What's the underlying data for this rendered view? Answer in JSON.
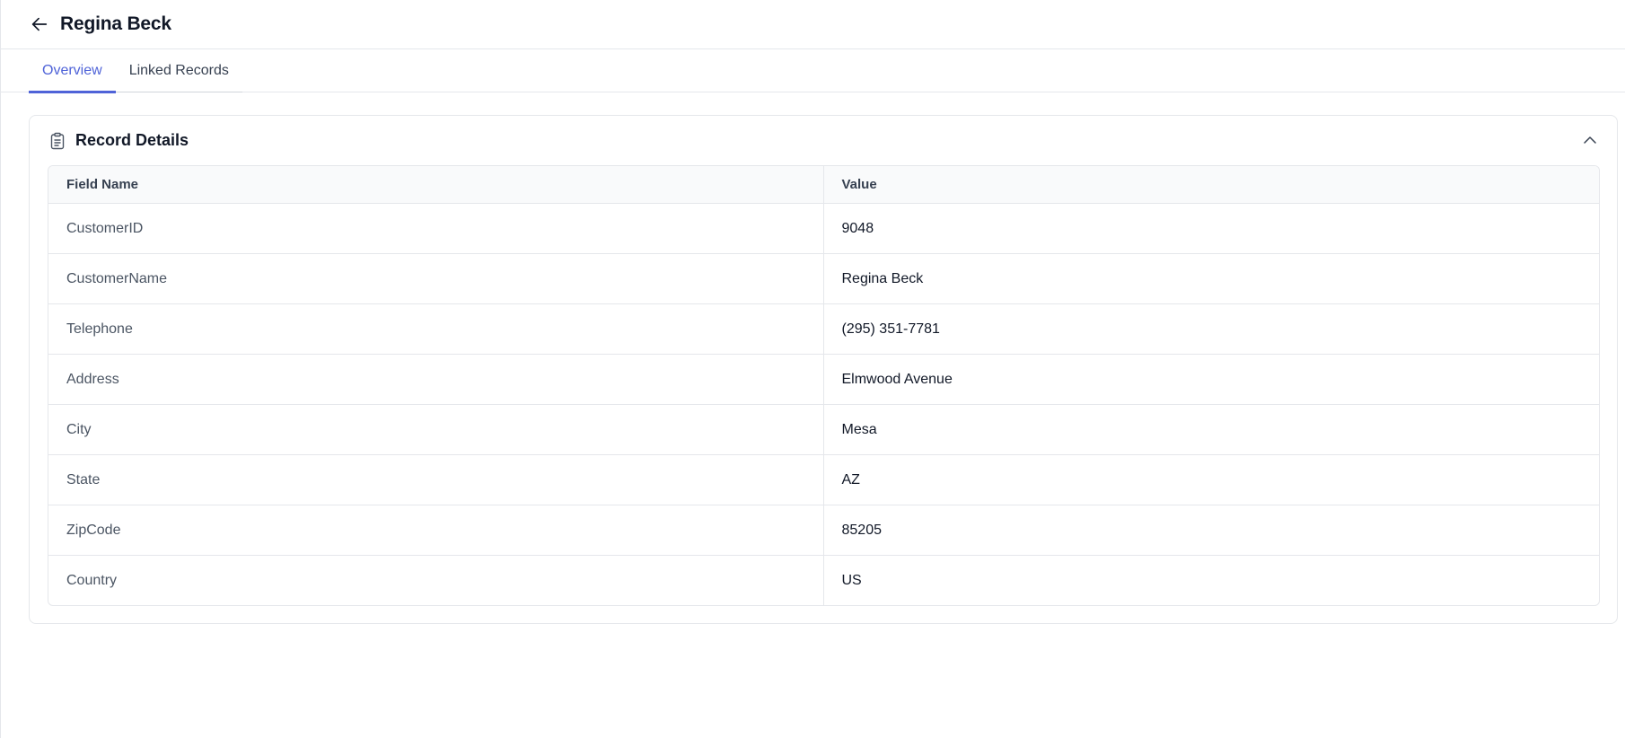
{
  "header": {
    "title": "Regina Beck",
    "back_icon": "arrow-left-icon"
  },
  "tabs": [
    {
      "label": "Overview",
      "active": true
    },
    {
      "label": "Linked Records",
      "active": false
    }
  ],
  "card": {
    "title": "Record Details",
    "icon": "clipboard-list-icon",
    "collapse_icon": "chevron-up-icon",
    "columns": [
      "Field Name",
      "Value"
    ],
    "rows": [
      {
        "field": "CustomerID",
        "value": "9048"
      },
      {
        "field": "CustomerName",
        "value": "Regina Beck"
      },
      {
        "field": "Telephone",
        "value": "(295) 351-7781"
      },
      {
        "field": "Address",
        "value": "Elmwood Avenue"
      },
      {
        "field": "City",
        "value": "Mesa"
      },
      {
        "field": "State",
        "value": "AZ"
      },
      {
        "field": "ZipCode",
        "value": "85205"
      },
      {
        "field": "Country",
        "value": "US"
      }
    ]
  },
  "colors": {
    "accent": "#4f63d8",
    "border": "#e5e7eb",
    "header_bg": "#f9fafb"
  }
}
